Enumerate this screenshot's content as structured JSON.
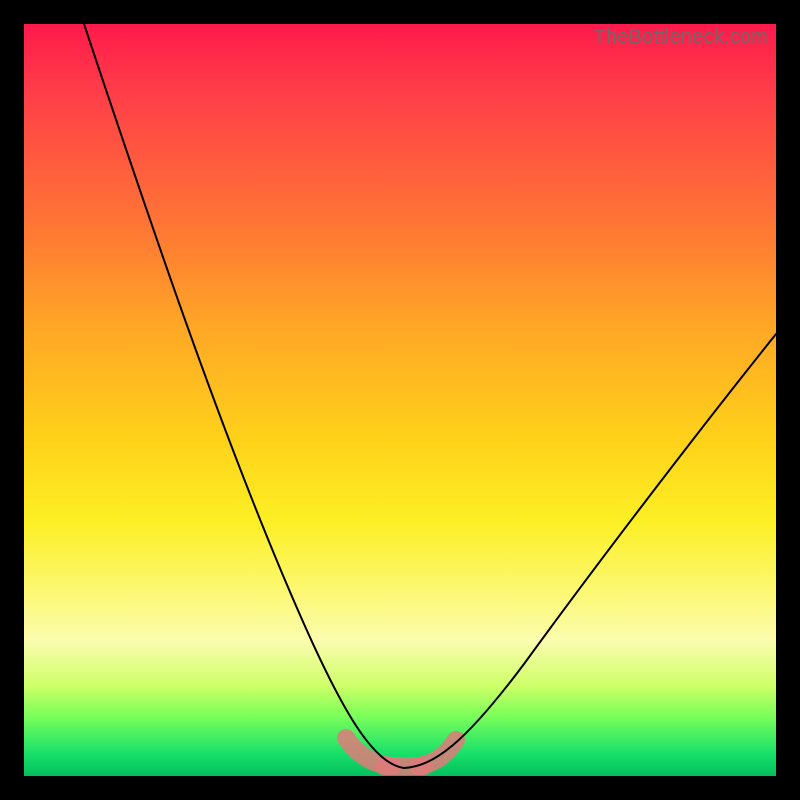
{
  "watermark": "TheBottleneck.com",
  "colors": {
    "frame": "#000000",
    "curve_stroke": "#000000",
    "basin_marker": "#e07a7a",
    "gradient_top": "#ff1a4b",
    "gradient_bottom": "#03c05c"
  },
  "chart_data": {
    "type": "line",
    "title": "",
    "xlabel": "",
    "ylabel": "",
    "xlim": [
      0,
      100
    ],
    "ylim": [
      0,
      100
    ],
    "legend": false,
    "grid": false,
    "annotations": [
      {
        "text": "TheBottleneck.com",
        "position": "top-right"
      }
    ],
    "series": [
      {
        "name": "bottleneck-curve",
        "x": [
          8,
          13,
          18,
          23,
          28,
          33,
          38,
          42,
          46,
          48,
          50,
          52,
          55,
          60,
          66,
          74,
          82,
          90,
          100
        ],
        "values": [
          100,
          82,
          65,
          49,
          35,
          23,
          13,
          6,
          2,
          0.5,
          0.5,
          1,
          4,
          10,
          18,
          28,
          38,
          48,
          60
        ]
      }
    ],
    "markers": [
      {
        "name": "basin-left",
        "x": 44,
        "y": 3
      },
      {
        "name": "basin-center",
        "x": 49,
        "y": 0.5
      },
      {
        "name": "basin-right",
        "x": 54,
        "y": 2
      }
    ]
  }
}
